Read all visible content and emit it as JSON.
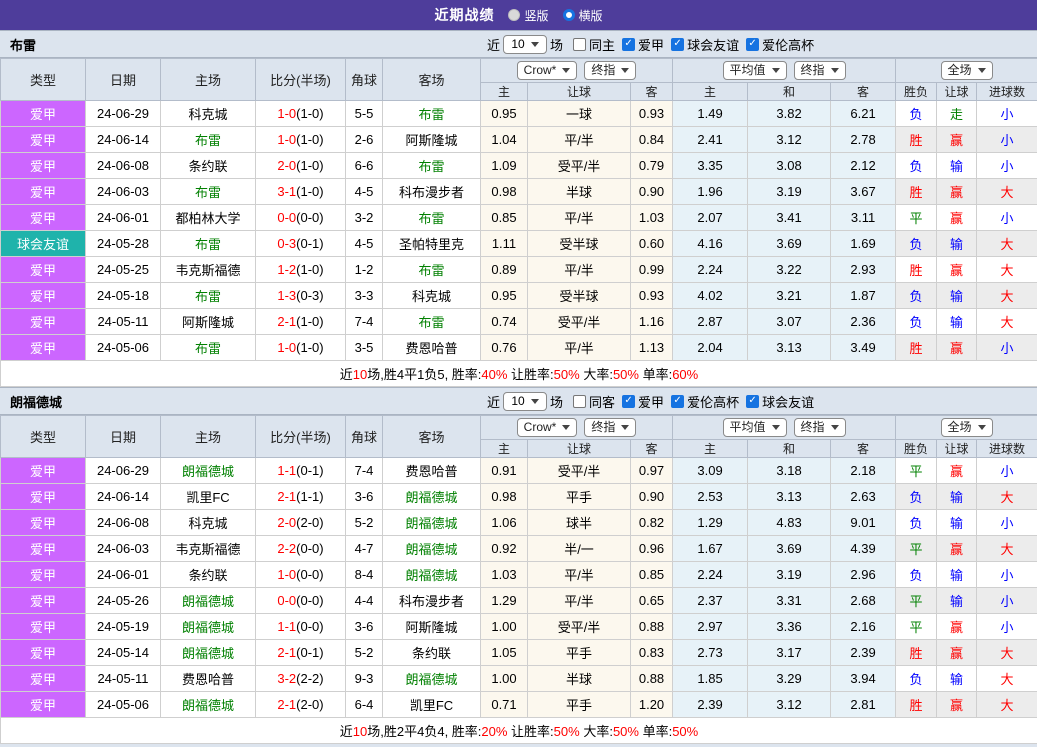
{
  "page": {
    "title": "近期战绩",
    "view_options": [
      {
        "label": "竖版",
        "selected": true
      },
      {
        "label": "横版",
        "selected": false
      }
    ]
  },
  "colors": {
    "topbar": "#4e3d9b",
    "panel": "#dce4ee",
    "league-violet": "#cc66ff",
    "league-teal": "#1fb3ab",
    "asia-bg": "#fcf8ee",
    "euro-bg": "#e7f2f8",
    "alt-row": "#ececec",
    "checkbox-blue": "#1673e1",
    "red": "#ff0000",
    "green": "#008000",
    "blue": "#0000ff"
  },
  "columns": {
    "type": "类型",
    "date": "日期",
    "home": "主场",
    "score": "比分(半场)",
    "corner": "角球",
    "away": "客场",
    "asia_home": "主",
    "asia_handicap": "让球",
    "asia_away": "客",
    "euro_home": "主",
    "euro_draw": "和",
    "euro_away": "客",
    "outcome": "胜负",
    "handicap_result": "让球",
    "goals": "进球数"
  },
  "tables": [
    {
      "team": "布雷",
      "filter": {
        "recent_label": "近",
        "count": "10",
        "games_label": "场",
        "checkboxes": [
          {
            "label": "同主",
            "checked": false
          },
          {
            "label": "爱甲",
            "checked": true
          },
          {
            "label": "球会友谊",
            "checked": true
          },
          {
            "label": "爱伦高杯",
            "checked": true
          }
        ]
      },
      "dropdowns": {
        "company": "Crow*",
        "company_stage": "终指",
        "europe": "平均值",
        "europe_stage": "终指",
        "scope": "全场"
      },
      "rows": [
        {
          "league": "爱甲",
          "friendly": false,
          "date": "24-06-29",
          "home": "科克城",
          "home_hl": false,
          "ft": "1-0",
          "ht": "(1-0)",
          "corner": "5-5",
          "away": "布雷",
          "away_hl": true,
          "asia": [
            "0.95",
            "一球",
            "0.93"
          ],
          "euro": [
            "1.49",
            "3.82",
            "6.21"
          ],
          "results": [
            [
              "负",
              "blue"
            ],
            [
              "走",
              "green"
            ],
            [
              "小",
              "blue"
            ]
          ]
        },
        {
          "league": "爱甲",
          "friendly": false,
          "date": "24-06-14",
          "home": "布雷",
          "home_hl": true,
          "ft": "1-0",
          "ht": "(1-0)",
          "corner": "2-6",
          "away": "阿斯隆城",
          "away_hl": false,
          "asia": [
            "1.04",
            "平/半",
            "0.84"
          ],
          "euro": [
            "2.41",
            "3.12",
            "2.78"
          ],
          "results": [
            [
              "胜",
              "red"
            ],
            [
              "赢",
              "red"
            ],
            [
              "小",
              "blue"
            ]
          ]
        },
        {
          "league": "爱甲",
          "friendly": false,
          "date": "24-06-08",
          "home": "条约联",
          "home_hl": false,
          "ft": "2-0",
          "ht": "(1-0)",
          "corner": "6-6",
          "away": "布雷",
          "away_hl": true,
          "asia": [
            "1.09",
            "受平/半",
            "0.79"
          ],
          "euro": [
            "3.35",
            "3.08",
            "2.12"
          ],
          "results": [
            [
              "负",
              "blue"
            ],
            [
              "输",
              "blue"
            ],
            [
              "小",
              "blue"
            ]
          ]
        },
        {
          "league": "爱甲",
          "friendly": false,
          "date": "24-06-03",
          "home": "布雷",
          "home_hl": true,
          "ft": "3-1",
          "ht": "(1-0)",
          "corner": "4-5",
          "away": "科布漫步者",
          "away_hl": false,
          "asia": [
            "0.98",
            "半球",
            "0.90"
          ],
          "euro": [
            "1.96",
            "3.19",
            "3.67"
          ],
          "results": [
            [
              "胜",
              "red"
            ],
            [
              "赢",
              "red"
            ],
            [
              "大",
              "red"
            ]
          ]
        },
        {
          "league": "爱甲",
          "friendly": false,
          "date": "24-06-01",
          "home": "都柏林大学",
          "home_hl": false,
          "ft": "0-0",
          "ht": "(0-0)",
          "corner": "3-2",
          "away": "布雷",
          "away_hl": true,
          "asia": [
            "0.85",
            "平/半",
            "1.03"
          ],
          "euro": [
            "2.07",
            "3.41",
            "3.11"
          ],
          "results": [
            [
              "平",
              "green"
            ],
            [
              "赢",
              "red"
            ],
            [
              "小",
              "blue"
            ]
          ]
        },
        {
          "league": "球会友谊",
          "friendly": true,
          "date": "24-05-28",
          "home": "布雷",
          "home_hl": true,
          "ft": "0-3",
          "ht": "(0-1)",
          "corner": "4-5",
          "away": "圣帕特里克",
          "away_hl": false,
          "asia": [
            "1.11",
            "受半球",
            "0.60"
          ],
          "euro": [
            "4.16",
            "3.69",
            "1.69"
          ],
          "results": [
            [
              "负",
              "blue"
            ],
            [
              "输",
              "blue"
            ],
            [
              "大",
              "red"
            ]
          ]
        },
        {
          "league": "爱甲",
          "friendly": false,
          "date": "24-05-25",
          "home": "韦克斯福德",
          "home_hl": false,
          "ft": "1-2",
          "ht": "(1-0)",
          "corner": "1-2",
          "away": "布雷",
          "away_hl": true,
          "asia": [
            "0.89",
            "平/半",
            "0.99"
          ],
          "euro": [
            "2.24",
            "3.22",
            "2.93"
          ],
          "results": [
            [
              "胜",
              "red"
            ],
            [
              "赢",
              "red"
            ],
            [
              "大",
              "red"
            ]
          ]
        },
        {
          "league": "爱甲",
          "friendly": false,
          "date": "24-05-18",
          "home": "布雷",
          "home_hl": true,
          "ft": "1-3",
          "ht": "(0-3)",
          "corner": "3-3",
          "away": "科克城",
          "away_hl": false,
          "asia": [
            "0.95",
            "受半球",
            "0.93"
          ],
          "euro": [
            "4.02",
            "3.21",
            "1.87"
          ],
          "results": [
            [
              "负",
              "blue"
            ],
            [
              "输",
              "blue"
            ],
            [
              "大",
              "red"
            ]
          ]
        },
        {
          "league": "爱甲",
          "friendly": false,
          "date": "24-05-11",
          "home": "阿斯隆城",
          "home_hl": false,
          "ft": "2-1",
          "ht": "(1-0)",
          "corner": "7-4",
          "away": "布雷",
          "away_hl": true,
          "asia": [
            "0.74",
            "受平/半",
            "1.16"
          ],
          "euro": [
            "2.87",
            "3.07",
            "2.36"
          ],
          "results": [
            [
              "负",
              "blue"
            ],
            [
              "输",
              "blue"
            ],
            [
              "大",
              "red"
            ]
          ]
        },
        {
          "league": "爱甲",
          "friendly": false,
          "date": "24-05-06",
          "home": "布雷",
          "home_hl": true,
          "ft": "1-0",
          "ht": "(1-0)",
          "corner": "3-5",
          "away": "费恩哈普",
          "away_hl": false,
          "asia": [
            "0.76",
            "平/半",
            "1.13"
          ],
          "euro": [
            "2.04",
            "3.13",
            "3.49"
          ],
          "results": [
            [
              "胜",
              "red"
            ],
            [
              "赢",
              "red"
            ],
            [
              "小",
              "blue"
            ]
          ]
        }
      ],
      "summary": [
        {
          "text": "近"
        },
        {
          "text": "10",
          "red": true
        },
        {
          "text": "场,胜4平1负5, 胜率:"
        },
        {
          "text": "40%",
          "red": true
        },
        {
          "text": " 让胜率:"
        },
        {
          "text": "50%",
          "red": true
        },
        {
          "text": " 大率:"
        },
        {
          "text": "50%",
          "red": true
        },
        {
          "text": " 单率:"
        },
        {
          "text": "60%",
          "red": true
        }
      ]
    },
    {
      "team": "朗福德城",
      "filter": {
        "recent_label": "近",
        "count": "10",
        "games_label": "场",
        "checkboxes": [
          {
            "label": "同客",
            "checked": false
          },
          {
            "label": "爱甲",
            "checked": true
          },
          {
            "label": "爱伦高杯",
            "checked": true
          },
          {
            "label": "球会友谊",
            "checked": true
          }
        ]
      },
      "dropdowns": {
        "company": "Crow*",
        "company_stage": "终指",
        "europe": "平均值",
        "europe_stage": "终指",
        "scope": "全场"
      },
      "rows": [
        {
          "league": "爱甲",
          "friendly": false,
          "date": "24-06-29",
          "home": "朗福德城",
          "home_hl": true,
          "ft": "1-1",
          "ht": "(0-1)",
          "corner": "7-4",
          "away": "费恩哈普",
          "away_hl": false,
          "asia": [
            "0.91",
            "受平/半",
            "0.97"
          ],
          "euro": [
            "3.09",
            "3.18",
            "2.18"
          ],
          "results": [
            [
              "平",
              "green"
            ],
            [
              "赢",
              "red"
            ],
            [
              "小",
              "blue"
            ]
          ]
        },
        {
          "league": "爱甲",
          "friendly": false,
          "date": "24-06-14",
          "home": "凯里FC",
          "home_hl": false,
          "ft": "2-1",
          "ht": "(1-1)",
          "corner": "3-6",
          "away": "朗福德城",
          "away_hl": true,
          "asia": [
            "0.98",
            "平手",
            "0.90"
          ],
          "euro": [
            "2.53",
            "3.13",
            "2.63"
          ],
          "results": [
            [
              "负",
              "blue"
            ],
            [
              "输",
              "blue"
            ],
            [
              "大",
              "red"
            ]
          ]
        },
        {
          "league": "爱甲",
          "friendly": false,
          "date": "24-06-08",
          "home": "科克城",
          "home_hl": false,
          "ft": "2-0",
          "ht": "(2-0)",
          "corner": "5-2",
          "away": "朗福德城",
          "away_hl": true,
          "asia": [
            "1.06",
            "球半",
            "0.82"
          ],
          "euro": [
            "1.29",
            "4.83",
            "9.01"
          ],
          "results": [
            [
              "负",
              "blue"
            ],
            [
              "输",
              "blue"
            ],
            [
              "小",
              "blue"
            ]
          ]
        },
        {
          "league": "爱甲",
          "friendly": false,
          "date": "24-06-03",
          "home": "韦克斯福德",
          "home_hl": false,
          "ft": "2-2",
          "ht": "(0-0)",
          "corner": "4-7",
          "away": "朗福德城",
          "away_hl": true,
          "asia": [
            "0.92",
            "半/一",
            "0.96"
          ],
          "euro": [
            "1.67",
            "3.69",
            "4.39"
          ],
          "results": [
            [
              "平",
              "green"
            ],
            [
              "赢",
              "red"
            ],
            [
              "大",
              "red"
            ]
          ]
        },
        {
          "league": "爱甲",
          "friendly": false,
          "date": "24-06-01",
          "home": "条约联",
          "home_hl": false,
          "ft": "1-0",
          "ht": "(0-0)",
          "corner": "8-4",
          "away": "朗福德城",
          "away_hl": true,
          "asia": [
            "1.03",
            "平/半",
            "0.85"
          ],
          "euro": [
            "2.24",
            "3.19",
            "2.96"
          ],
          "results": [
            [
              "负",
              "blue"
            ],
            [
              "输",
              "blue"
            ],
            [
              "小",
              "blue"
            ]
          ]
        },
        {
          "league": "爱甲",
          "friendly": false,
          "date": "24-05-26",
          "home": "朗福德城",
          "home_hl": true,
          "ft": "0-0",
          "ht": "(0-0)",
          "corner": "4-4",
          "away": "科布漫步者",
          "away_hl": false,
          "asia": [
            "1.29",
            "平/半",
            "0.65"
          ],
          "euro": [
            "2.37",
            "3.31",
            "2.68"
          ],
          "results": [
            [
              "平",
              "green"
            ],
            [
              "输",
              "blue"
            ],
            [
              "小",
              "blue"
            ]
          ]
        },
        {
          "league": "爱甲",
          "friendly": false,
          "date": "24-05-19",
          "home": "朗福德城",
          "home_hl": true,
          "ft": "1-1",
          "ht": "(0-0)",
          "corner": "3-6",
          "away": "阿斯隆城",
          "away_hl": false,
          "asia": [
            "1.00",
            "受平/半",
            "0.88"
          ],
          "euro": [
            "2.97",
            "3.36",
            "2.16"
          ],
          "results": [
            [
              "平",
              "green"
            ],
            [
              "赢",
              "red"
            ],
            [
              "小",
              "blue"
            ]
          ]
        },
        {
          "league": "爱甲",
          "friendly": false,
          "date": "24-05-14",
          "home": "朗福德城",
          "home_hl": true,
          "ft": "2-1",
          "ht": "(0-1)",
          "corner": "5-2",
          "away": "条约联",
          "away_hl": false,
          "asia": [
            "1.05",
            "平手",
            "0.83"
          ],
          "euro": [
            "2.73",
            "3.17",
            "2.39"
          ],
          "results": [
            [
              "胜",
              "red"
            ],
            [
              "赢",
              "red"
            ],
            [
              "大",
              "red"
            ]
          ]
        },
        {
          "league": "爱甲",
          "friendly": false,
          "date": "24-05-11",
          "home": "费恩哈普",
          "home_hl": false,
          "ft": "3-2",
          "ht": "(2-2)",
          "corner": "9-3",
          "away": "朗福德城",
          "away_hl": true,
          "asia": [
            "1.00",
            "半球",
            "0.88"
          ],
          "euro": [
            "1.85",
            "3.29",
            "3.94"
          ],
          "results": [
            [
              "负",
              "blue"
            ],
            [
              "输",
              "blue"
            ],
            [
              "大",
              "red"
            ]
          ]
        },
        {
          "league": "爱甲",
          "friendly": false,
          "date": "24-05-06",
          "home": "朗福德城",
          "home_hl": true,
          "ft": "2-1",
          "ht": "(2-0)",
          "corner": "6-4",
          "away": "凯里FC",
          "away_hl": false,
          "asia": [
            "0.71",
            "平手",
            "1.20"
          ],
          "euro": [
            "2.39",
            "3.12",
            "2.81"
          ],
          "results": [
            [
              "胜",
              "red"
            ],
            [
              "赢",
              "red"
            ],
            [
              "大",
              "red"
            ]
          ]
        }
      ],
      "summary": [
        {
          "text": "近"
        },
        {
          "text": "10",
          "red": true
        },
        {
          "text": "场,胜2平4负4, 胜率:"
        },
        {
          "text": "20%",
          "red": true
        },
        {
          "text": " 让胜率:"
        },
        {
          "text": "50%",
          "red": true
        },
        {
          "text": " 大率:"
        },
        {
          "text": "50%",
          "red": true
        },
        {
          "text": " 单率:"
        },
        {
          "text": "50%",
          "red": true
        }
      ]
    }
  ]
}
